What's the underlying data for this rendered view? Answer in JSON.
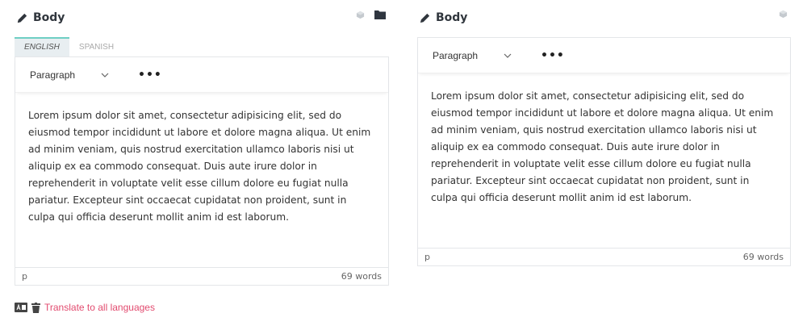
{
  "left_field": {
    "title": "Body",
    "icons": [
      "pencil-icon",
      "cube-icon",
      "folder-icon"
    ],
    "tabs": [
      {
        "label": "ENGLISH",
        "active": true
      },
      {
        "label": "SPANISH",
        "active": false
      }
    ],
    "toolbar": {
      "style_value": "Paragraph",
      "more_label": "•••"
    },
    "content": "Lorem ipsum dolor sit amet, consectetur adipisicing elit, sed do eiusmod tempor incididunt ut labore et dolore magna aliqua. Ut enim ad minim veniam, quis nostrud exercitation ullamco laboris nisi ut aliquip ex ea commodo consequat. Duis aute irure dolor in reprehenderit in voluptate velit esse cillum dolore eu fugiat nulla pariatur. Excepteur sint occaecat cupidatat non proident, sunt in culpa qui officia deserunt mollit anim id est laborum.",
    "status_path": "p",
    "word_count": "69 words"
  },
  "right_field": {
    "title": "Body",
    "icons": [
      "pencil-icon",
      "cube-icon"
    ],
    "toolbar": {
      "style_value": "Paragraph",
      "more_label": "•••"
    },
    "content": "Lorem ipsum dolor sit amet, consectetur adipisicing elit, sed do eiusmod tempor incididunt ut labore et dolore magna aliqua. Ut enim ad minim veniam, quis nostrud exercitation ullamco laboris nisi ut aliquip ex ea commodo consequat. Duis aute irure dolor in reprehenderit in voluptate velit esse cillum dolore eu fugiat nulla pariatur. Excepteur sint occaecat cupidatat non proident, sunt in culpa qui officia deserunt mollit anim id est laborum.",
    "status_path": "p",
    "word_count": "69 words"
  },
  "translate": {
    "label": "Translate to all languages",
    "icons": [
      "language-icon",
      "trash-icon"
    ]
  },
  "colors": {
    "accent_link": "#e24b6f",
    "tab_active_border": "#6fcfc4",
    "tab_active_bg": "#e8eef1"
  }
}
